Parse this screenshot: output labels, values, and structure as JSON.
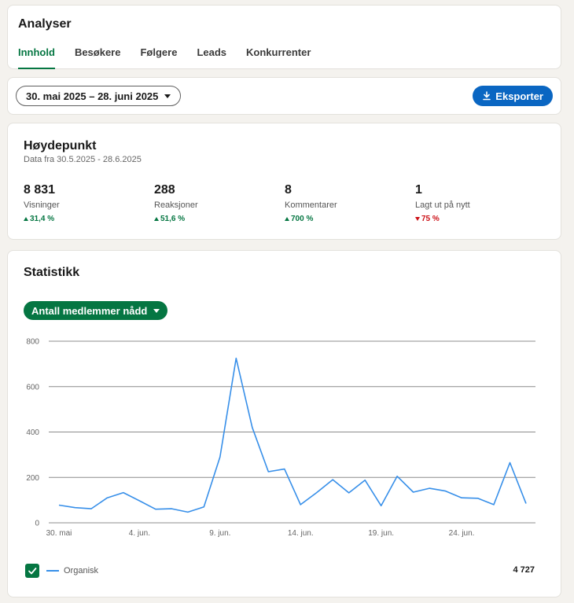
{
  "header": {
    "title": "Analyser",
    "tabs": [
      {
        "label": "Innhold",
        "active": true
      },
      {
        "label": "Besøkere"
      },
      {
        "label": "Følgere"
      },
      {
        "label": "Leads"
      },
      {
        "label": "Konkurrenter"
      }
    ]
  },
  "toolbar": {
    "date_range": "30. mai 2025 – 28. juni 2025",
    "export_label": "Eksporter"
  },
  "highlights": {
    "title": "Høydepunkt",
    "subtitle": "Data fra 30.5.2025 - 28.6.2025",
    "metrics": [
      {
        "value": "8 831",
        "label": "Visninger",
        "change": "31,4 %",
        "direction": "up"
      },
      {
        "value": "288",
        "label": "Reaksjoner",
        "change": "51,6 %",
        "direction": "up"
      },
      {
        "value": "8",
        "label": "Kommentarer",
        "change": "700 %",
        "direction": "up"
      },
      {
        "value": "1",
        "label": "Lagt ut på nytt",
        "change": "75 %",
        "direction": "down"
      }
    ]
  },
  "statistics": {
    "title": "Statistikk",
    "metric_select": "Antall medlemmer nådd",
    "legend_label": "Organisk",
    "total": "4 727",
    "colors": {
      "line": "#378fe9",
      "accent": "#057642"
    }
  },
  "chart_data": {
    "type": "line",
    "xlabel": "",
    "ylabel": "",
    "ylim": [
      0,
      800
    ],
    "yticks": [
      0,
      200,
      400,
      600,
      800
    ],
    "x_ticks": [
      {
        "index": 0,
        "label": "30. mai"
      },
      {
        "index": 5,
        "label": "4. jun."
      },
      {
        "index": 10,
        "label": "9. jun."
      },
      {
        "index": 15,
        "label": "14. jun."
      },
      {
        "index": 20,
        "label": "19. jun."
      },
      {
        "index": 25,
        "label": "24. jun."
      }
    ],
    "x": [
      "30. mai",
      "31. mai",
      "1. jun.",
      "2. jun.",
      "3. jun.",
      "4. jun.",
      "5. jun.",
      "6. jun.",
      "7. jun.",
      "8. jun.",
      "9. jun.",
      "10. jun.",
      "11. jun.",
      "12. jun.",
      "13. jun.",
      "14. jun.",
      "15. jun.",
      "16. jun.",
      "17. jun.",
      "18. jun.",
      "19. jun.",
      "20. jun.",
      "21. jun.",
      "22. jun.",
      "23. jun.",
      "24. jun.",
      "25. jun.",
      "26. jun.",
      "27. jun.",
      "28. jun."
    ],
    "series": [
      {
        "name": "Organisk",
        "values": [
          78,
          67,
          62,
          110,
          133,
          97,
          60,
          62,
          47,
          70,
          290,
          725,
          420,
          225,
          237,
          80,
          133,
          190,
          132,
          188,
          75,
          205,
          135,
          152,
          140,
          110,
          108,
          80,
          265,
          85
        ]
      }
    ],
    "grid": true,
    "legend": "bottom-left"
  }
}
